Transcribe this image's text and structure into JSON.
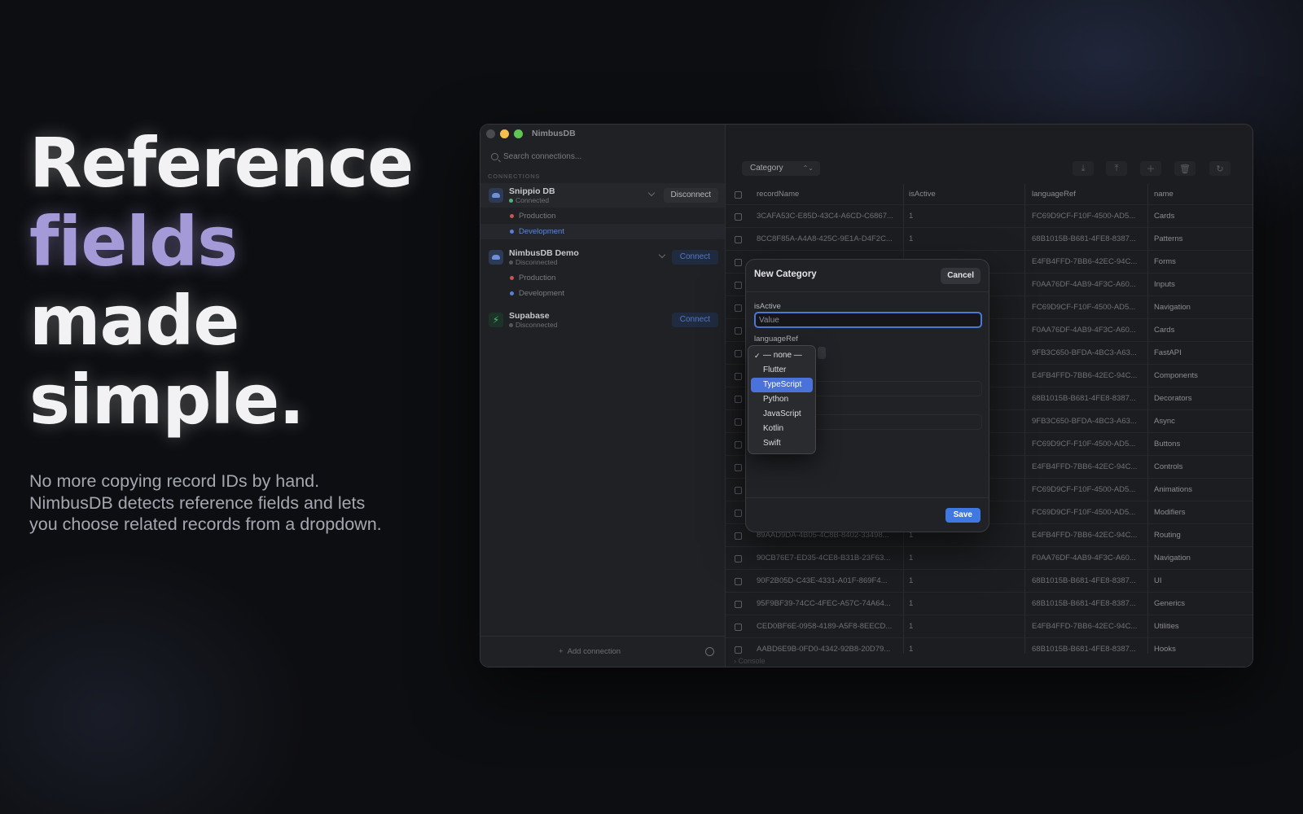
{
  "hero": {
    "line1": "Reference",
    "line2": "fields",
    "line3": "made",
    "line4": "simple.",
    "subtext": "No more copying record IDs by hand. NimbusDB detects reference fields and lets you choose related records from a dropdown."
  },
  "window": {
    "title": "NimbusDB"
  },
  "sidebar": {
    "search_placeholder": "Search connections...",
    "section_label": "CONNECTIONS",
    "connections": [
      {
        "name": "Snippio DB",
        "status": "Connected",
        "action": "Disconnect",
        "icon": "cloud-icon",
        "envs": [
          "Production",
          "Development"
        ],
        "selected_env": "Development"
      },
      {
        "name": "NimbusDB Demo",
        "status": "Disconnected",
        "action": "Connect",
        "icon": "cloud-icon",
        "envs": [
          "Production",
          "Development"
        ]
      },
      {
        "name": "Supabase",
        "status": "Disconnected",
        "action": "Connect",
        "icon": "bolt-icon"
      }
    ],
    "add_connection": "Add connection"
  },
  "toolbar": {
    "table": "Category"
  },
  "table": {
    "columns": [
      "recordName",
      "isActive",
      "languageRef",
      "name"
    ],
    "rows": [
      [
        "3CAFA53C-E85D-43C4-A6CD-C6867...",
        "1",
        "FC69D9CF-F10F-4500-AD5...",
        "Cards"
      ],
      [
        "8CC8F85A-A4A8-425C-9E1A-D4F2C...",
        "1",
        "68B1015B-B681-4FE8-8387...",
        "Patterns"
      ],
      [
        "",
        "",
        "E4FB4FFD-7BB6-42EC-94C...",
        "Forms"
      ],
      [
        "",
        "",
        "F0AA76DF-4AB9-4F3C-A60...",
        "Inputs"
      ],
      [
        "",
        "",
        "FC69D9CF-F10F-4500-AD5...",
        "Navigation"
      ],
      [
        "",
        "",
        "F0AA76DF-4AB9-4F3C-A60...",
        "Cards"
      ],
      [
        "",
        "",
        "9FB3C650-BFDA-4BC3-A63...",
        "FastAPI"
      ],
      [
        "",
        "",
        "E4FB4FFD-7BB6-42EC-94C...",
        "Components"
      ],
      [
        "",
        "",
        "68B1015B-B681-4FE8-8387...",
        "Decorators"
      ],
      [
        "",
        "",
        "9FB3C650-BFDA-4BC3-A63...",
        "Async"
      ],
      [
        "",
        "",
        "FC69D9CF-F10F-4500-AD5...",
        "Buttons"
      ],
      [
        "",
        "",
        "E4FB4FFD-7BB6-42EC-94C...",
        "Controls"
      ],
      [
        "",
        "",
        "FC69D9CF-F10F-4500-AD5...",
        "Animations"
      ],
      [
        "",
        "",
        "FC69D9CF-F10F-4500-AD5...",
        "Modifiers"
      ],
      [
        "89AAD9DA-4B05-4C8B-8402-33498...",
        "1",
        "E4FB4FFD-7BB6-42EC-94C...",
        "Routing"
      ],
      [
        "90CB76E7-ED35-4CE8-B31B-23F63...",
        "1",
        "F0AA76DF-4AB9-4F3C-A60...",
        "Navigation"
      ],
      [
        "90F2B05D-C43E-4331-A01F-869F4...",
        "1",
        "68B1015B-B681-4FE8-8387...",
        "UI"
      ],
      [
        "95F9BF39-74CC-4FEC-A57C-74A64...",
        "1",
        "68B1015B-B681-4FE8-8387...",
        "Generics"
      ],
      [
        "CED0BF6E-0958-4189-A5F8-8EECD...",
        "1",
        "E4FB4FFD-7BB6-42EC-94C...",
        "Utilities"
      ],
      [
        "AABD6E9B-0FD0-4342-92B8-20D79...",
        "1",
        "68B1015B-B681-4FE8-8387...",
        "Hooks"
      ]
    ],
    "console": "Console"
  },
  "modal": {
    "title": "New Category",
    "cancel": "Cancel",
    "field1_label": "isActive",
    "field1_placeholder": "Value",
    "field2_label": "languageRef",
    "save": "Save"
  },
  "dropdown": {
    "options": [
      "— none —",
      "Flutter",
      "TypeScript",
      "Python",
      "JavaScript",
      "Kotlin",
      "Swift"
    ],
    "checked": "— none —",
    "highlighted": "TypeScript"
  },
  "colors": {
    "accent": "#3f77e3",
    "headline_accent": "#a59ad8",
    "connected": "#4fb477"
  }
}
